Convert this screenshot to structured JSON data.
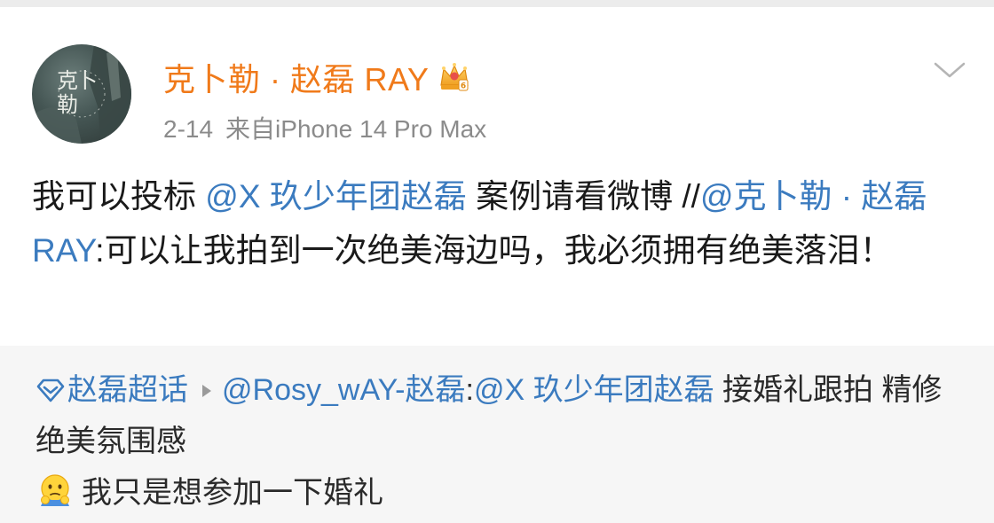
{
  "post": {
    "author": "克卜勒 · 赵磊 RAY",
    "avatar_text": "克卜勒",
    "date": "2-14",
    "source": "来自iPhone 14 Pro Max",
    "body": {
      "part1": "我可以投标 ",
      "mention1": "@X 玖少年团赵磊",
      "part2": " 案例请看微博 //",
      "mention2": "@克卜勒 · 赵磊 RAY",
      "part3": ":可以让我拍到一次绝美海边吗，我必须拥有绝美落泪！"
    }
  },
  "repost": {
    "topic": "赵磊超话",
    "author_mention": "@Rosy_wAY-赵磊",
    "colon": ":",
    "mention": "@X 玖少年团赵磊",
    "text": " 接婚礼跟拍 精修绝美氛围感",
    "reply": "我只是想参加一下婚礼"
  },
  "icons": {
    "badge": "crown-vip-icon",
    "more": "chevron-down-icon",
    "topic": "diamond-icon",
    "arrow": "play-arrow-icon",
    "emoji": "thinking-emoji-icon"
  },
  "colors": {
    "username": "#f07a1a",
    "link": "#3b7bbf",
    "meta": "#8b8b8b",
    "repost_bg": "#f6f6f6"
  }
}
